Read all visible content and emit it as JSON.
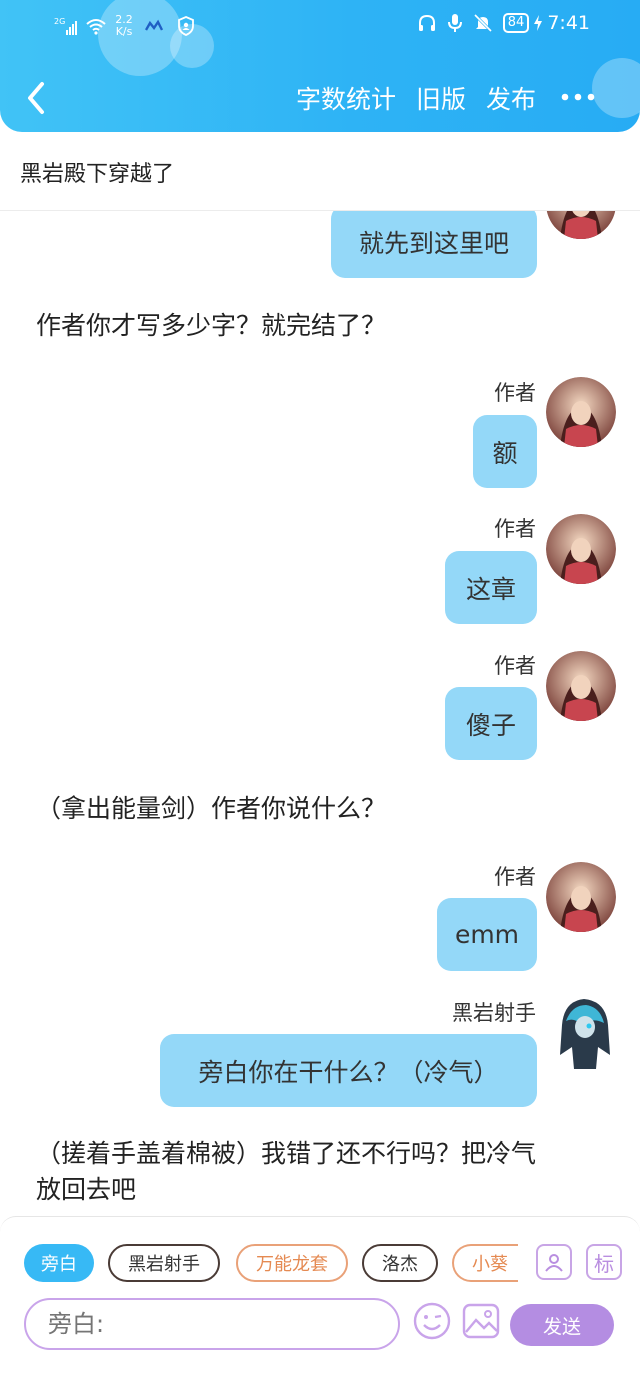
{
  "status_bar": {
    "net_type": "2G",
    "net_speed_top": "2.2",
    "net_speed_bottom": "K/s",
    "battery": "84",
    "time": "7:41"
  },
  "nav": {
    "word_count": "字数统计",
    "old_version": "旧版",
    "publish": "发布"
  },
  "story_title": "黑岩殿下穿越了",
  "messages": [
    {
      "kind": "bubble",
      "text": "就先到这里吧",
      "speaker": "author"
    },
    {
      "kind": "narration",
      "text": "作者你才写多少字？就完结了？"
    },
    {
      "kind": "bubble",
      "name": "作者",
      "text": "额",
      "speaker": "author"
    },
    {
      "kind": "bubble",
      "name": "作者",
      "text": "这章",
      "speaker": "author"
    },
    {
      "kind": "bubble",
      "name": "作者",
      "text": "傻子",
      "speaker": "author"
    },
    {
      "kind": "narration",
      "text": "（拿出能量剑）作者你说什么？"
    },
    {
      "kind": "bubble",
      "name": "作者",
      "text": "emm",
      "speaker": "author"
    },
    {
      "kind": "bubble",
      "name": "黑岩射手",
      "text": "旁白你在干什么？（冷气）",
      "speaker": "black-rock-shooter"
    },
    {
      "kind": "narration",
      "line1": "（搓着手盖着棉被）我错了还不行吗？把冷气",
      "line2": "放回去吧"
    }
  ],
  "composer": {
    "roles": [
      "旁白",
      "黑岩射手",
      "万能龙套",
      "洛杰",
      "小葵"
    ],
    "role_icons": [
      "contact-card-icon",
      "tag-icon"
    ],
    "tag_label": "标",
    "input_placeholder": "旁白:",
    "send_label": "发送"
  },
  "colors": {
    "header": "#2eb3f5",
    "bubble": "#94d8f8",
    "accent_purple": "#b48de2",
    "role_active": "#37b9f5"
  }
}
